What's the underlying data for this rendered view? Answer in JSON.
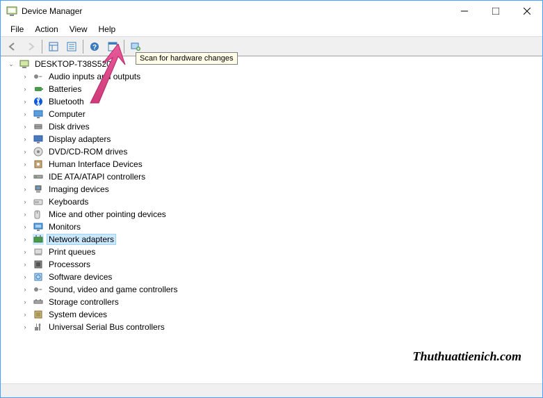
{
  "window": {
    "title": "Device Manager"
  },
  "menu": {
    "file": "File",
    "action": "Action",
    "view": "View",
    "help": "Help"
  },
  "tooltip": "Scan for hardware changes",
  "tree": {
    "root": "DESKTOP-T38S520",
    "items": [
      "Audio inputs and outputs",
      "Batteries",
      "Bluetooth",
      "Computer",
      "Disk drives",
      "Display adapters",
      "DVD/CD-ROM drives",
      "Human Interface Devices",
      "IDE ATA/ATAPI controllers",
      "Imaging devices",
      "Keyboards",
      "Mice and other pointing devices",
      "Monitors",
      "Network adapters",
      "Print queues",
      "Processors",
      "Software devices",
      "Sound, video and game controllers",
      "Storage controllers",
      "System devices",
      "Universal Serial Bus controllers"
    ],
    "selected": 13
  },
  "watermark": "Thuthuattienich.com"
}
